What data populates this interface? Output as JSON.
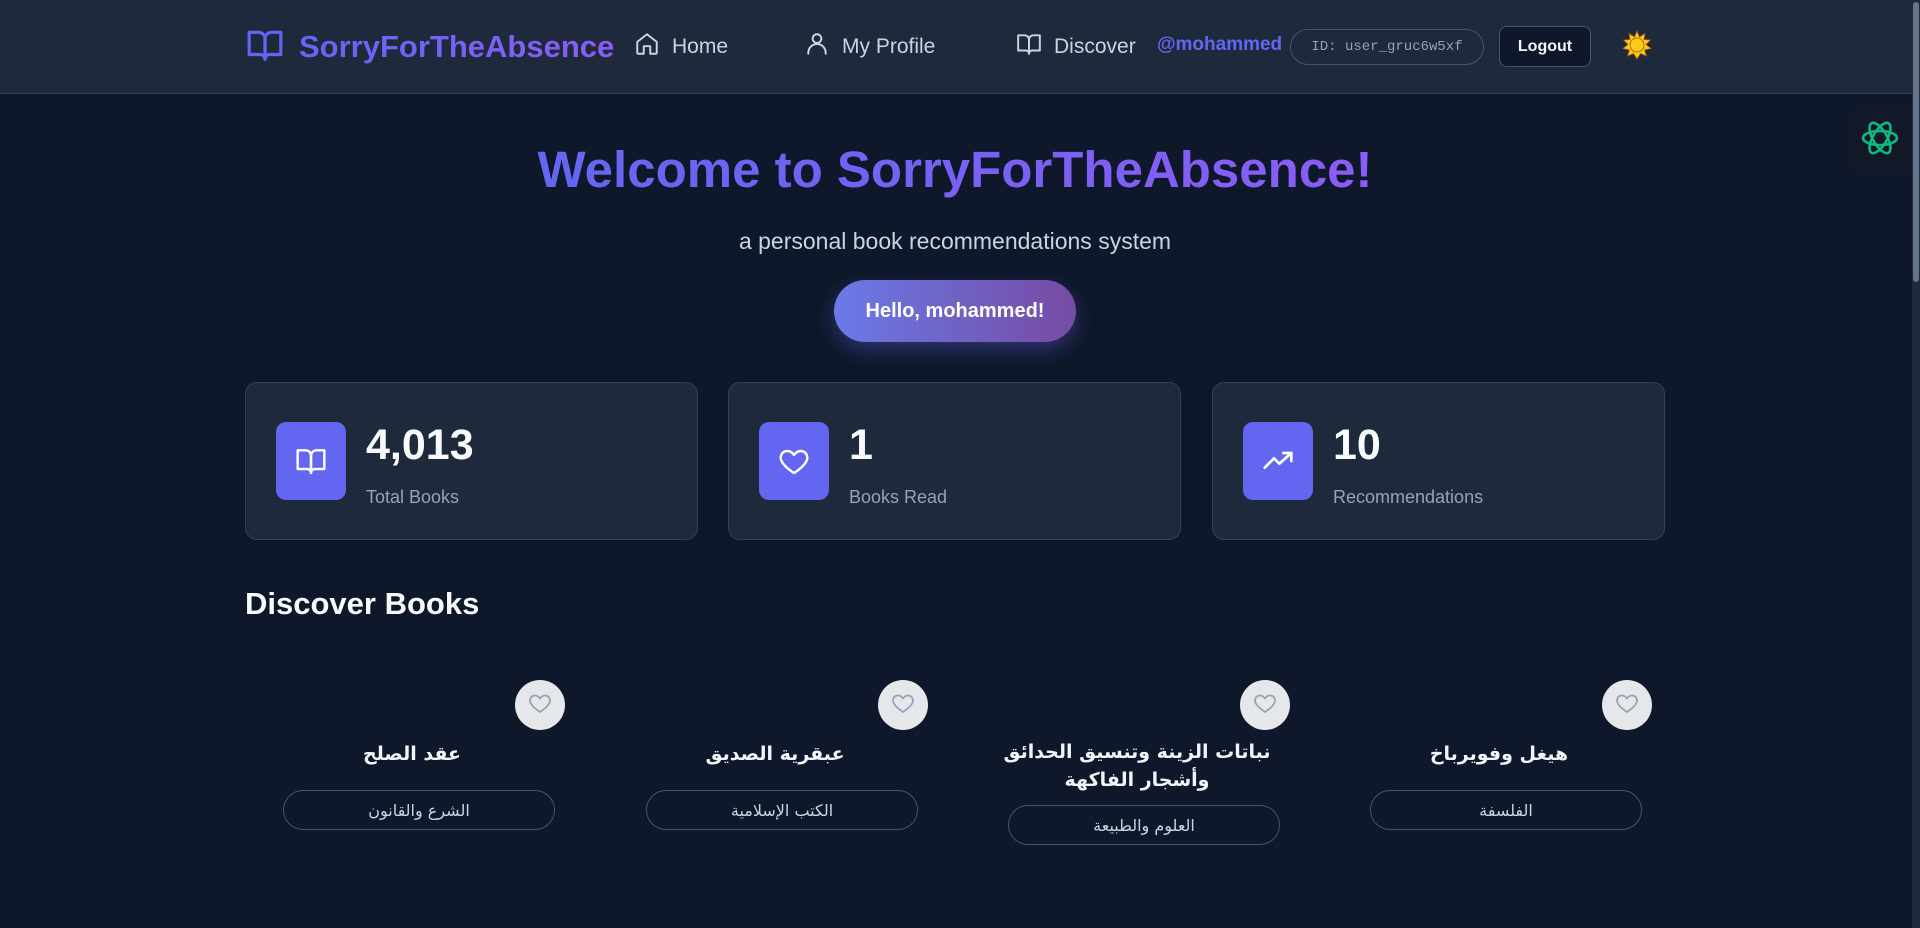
{
  "app": {
    "brand": "SorryForTheAbsence",
    "colors": {
      "accent": "#6366f1",
      "accent_end": "#8b5cf6",
      "background": "#0f172a",
      "surface": "#1e293b"
    }
  },
  "nav": {
    "home": "Home",
    "profile": "My Profile",
    "discover": "Discover",
    "username": "@mohammed",
    "user_id": "ID: user_gruc6w5xf",
    "logout": "Logout",
    "theme_icon": "sun-icon"
  },
  "hero": {
    "title": "Welcome to SorryForTheAbsence!",
    "subtitle": "a personal book recommendations system",
    "greeting": "Hello, mohammed!"
  },
  "stats": [
    {
      "value": "4,013",
      "label": "Total Books",
      "icon": "book-open-icon"
    },
    {
      "value": "1",
      "label": "Books Read",
      "icon": "heart-icon"
    },
    {
      "value": "10",
      "label": "Recommendations",
      "icon": "trending-up-icon"
    }
  ],
  "discover": {
    "title": "Discover Books",
    "books": [
      {
        "title": "عقد الصلح",
        "category": "الشرع والقانون"
      },
      {
        "title": "عبقرية الصديق",
        "category": "الكتب الإسلامية"
      },
      {
        "title": "نباتات الزينة وتنسيق الحدائق وأشجار الفاكهة",
        "category": "العلوم والطبيعة"
      },
      {
        "title": "هيغل وفويرباخ",
        "category": "الفلسفة"
      }
    ]
  }
}
